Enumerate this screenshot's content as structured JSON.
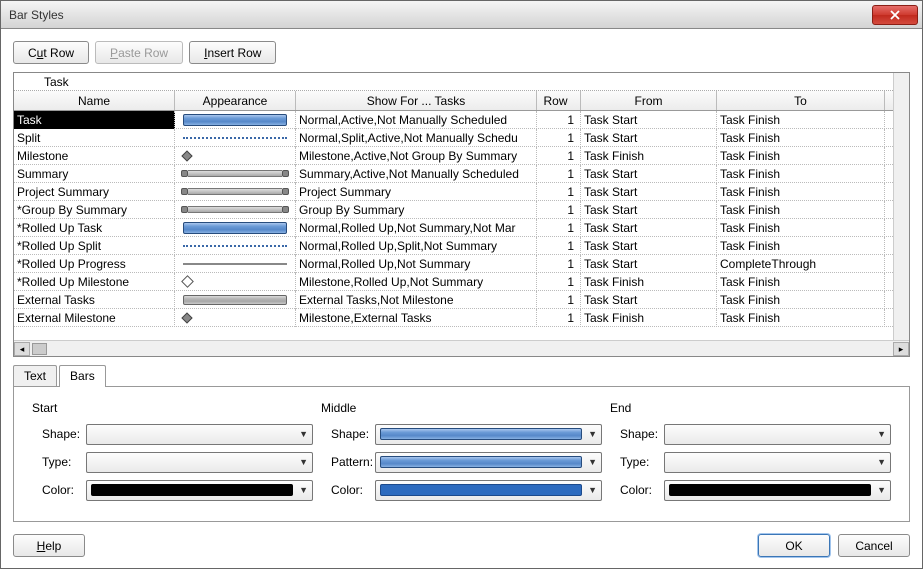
{
  "window": {
    "title": "Bar Styles"
  },
  "toolbar": {
    "cut_pre": "C",
    "cut_ul": "u",
    "cut_post": "t Row",
    "paste_pre": "",
    "paste_ul": "P",
    "paste_post": "aste Row",
    "insert_pre": "",
    "insert_ul": "I",
    "insert_post": "nsert Row"
  },
  "grid": {
    "row_label": "Task",
    "headers": {
      "name": "Name",
      "appearance": "Appearance",
      "show": "Show For ... Tasks",
      "row": "Row",
      "from": "From",
      "to": "To"
    },
    "rows": [
      {
        "name": "Task",
        "app": "bar-solid",
        "show": "Normal,Active,Not Manually Scheduled",
        "row": "1",
        "from": "Task Start",
        "to": "Task Finish",
        "selected": true
      },
      {
        "name": "Split",
        "app": "bar-dots",
        "show": "Normal,Split,Active,Not Manually Schedu",
        "row": "1",
        "from": "Task Start",
        "to": "Task Finish"
      },
      {
        "name": "Milestone",
        "app": "diamond-filled",
        "show": "Milestone,Active,Not Group By Summary",
        "row": "1",
        "from": "Task Finish",
        "to": "Task Finish"
      },
      {
        "name": "Summary",
        "app": "bar-with-ends",
        "show": "Summary,Active,Not Manually Scheduled",
        "row": "1",
        "from": "Task Start",
        "to": "Task Finish"
      },
      {
        "name": "Project Summary",
        "app": "bar-with-ends",
        "show": "Project Summary",
        "row": "1",
        "from": "Task Start",
        "to": "Task Finish"
      },
      {
        "name": "*Group By Summary",
        "app": "bar-with-ends",
        "show": "Group By Summary",
        "row": "1",
        "from": "Task Start",
        "to": "Task Finish"
      },
      {
        "name": "*Rolled Up Task",
        "app": "bar-solid",
        "show": "Normal,Rolled Up,Not Summary,Not Mar",
        "row": "1",
        "from": "Task Start",
        "to": "Task Finish"
      },
      {
        "name": "*Rolled Up Split",
        "app": "bar-dots",
        "show": "Normal,Rolled Up,Split,Not Summary",
        "row": "1",
        "from": "Task Start",
        "to": "Task Finish"
      },
      {
        "name": "*Rolled Up Progress",
        "app": "bar-line",
        "show": "Normal,Rolled Up,Not Summary",
        "row": "1",
        "from": "Task Start",
        "to": "CompleteThrough"
      },
      {
        "name": "*Rolled Up Milestone",
        "app": "diamond",
        "show": "Milestone,Rolled Up,Not Summary",
        "row": "1",
        "from": "Task Finish",
        "to": "Task Finish"
      },
      {
        "name": "External Tasks",
        "app": "bar-gray",
        "show": "External Tasks,Not Milestone",
        "row": "1",
        "from": "Task Start",
        "to": "Task Finish"
      },
      {
        "name": "External Milestone",
        "app": "diamond-filled",
        "show": "Milestone,External Tasks",
        "row": "1",
        "from": "Task Finish",
        "to": "Task Finish"
      }
    ]
  },
  "tabs": {
    "text": "Text",
    "bars": "Bars"
  },
  "bars_panel": {
    "start": {
      "title": "Start",
      "shape": "Shape:",
      "type": "Type:",
      "color": "Color:"
    },
    "middle": {
      "title": "Middle",
      "shape": "Shape:",
      "pattern": "Pattern:",
      "color": "Color:"
    },
    "end": {
      "title": "End",
      "shape": "Shape:",
      "type": "Type:",
      "color": "Color:"
    }
  },
  "footer": {
    "help_ul": "H",
    "help_post": "elp",
    "ok": "OK",
    "cancel": "Cancel"
  }
}
